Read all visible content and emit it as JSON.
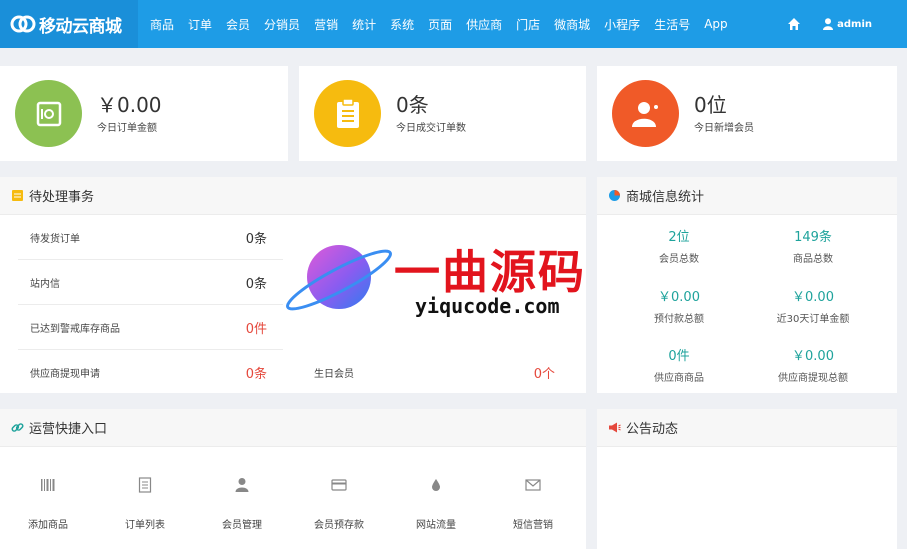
{
  "app": {
    "logo_text": "移动云商城"
  },
  "nav": {
    "items": [
      "商品",
      "订单",
      "会员",
      "分销员",
      "营销",
      "统计",
      "系统",
      "页面",
      "供应商",
      "门店",
      "微商城",
      "小程序",
      "生活号",
      "App"
    ],
    "user": "admin"
  },
  "stats": [
    {
      "value": "￥0.00",
      "label": "今日订单金额",
      "color": "#8cc152",
      "icon": "safe-icon"
    },
    {
      "value": "0条",
      "label": "今日成交订单数",
      "color": "#f6bb0f",
      "icon": "clipboard-icon"
    },
    {
      "value": "0位",
      "label": "今日新增会员",
      "color": "#f05a28",
      "icon": "user-add-icon"
    }
  ],
  "tasks": {
    "title": "待处理事务",
    "left": [
      {
        "label": "待发货订单",
        "value": "0条"
      },
      {
        "label": "站内信",
        "value": "0条"
      },
      {
        "label": "已达到警戒库存商品",
        "value": "0件"
      },
      {
        "label": "供应商提现申请",
        "value": "0条"
      }
    ],
    "right": [
      {
        "label": "生日会员",
        "value": "0个"
      }
    ]
  },
  "mall_stats": {
    "title": "商城信息统计",
    "items": [
      {
        "value": "2位",
        "label": "会员总数"
      },
      {
        "value": "149条",
        "label": "商品总数"
      },
      {
        "value": "￥0.00",
        "label": "预付款总额"
      },
      {
        "value": "￥0.00",
        "label": "近30天订单金额"
      },
      {
        "value": "0件",
        "label": "供应商商品"
      },
      {
        "value": "￥0.00",
        "label": "供应商提现总额"
      }
    ]
  },
  "quick": {
    "title": "运营快捷入口",
    "items": [
      {
        "label": "添加商品",
        "icon": "barcode-icon"
      },
      {
        "label": "订单列表",
        "icon": "list-icon"
      },
      {
        "label": "会员管理",
        "icon": "user-icon"
      },
      {
        "label": "会员预存款",
        "icon": "card-icon"
      },
      {
        "label": "网站流量",
        "icon": "drop-icon"
      },
      {
        "label": "短信营销",
        "icon": "mail-icon"
      }
    ]
  },
  "notice": {
    "title": "公告动态"
  },
  "watermark": {
    "cn": "一曲源码",
    "en": "yiqucode.com"
  }
}
